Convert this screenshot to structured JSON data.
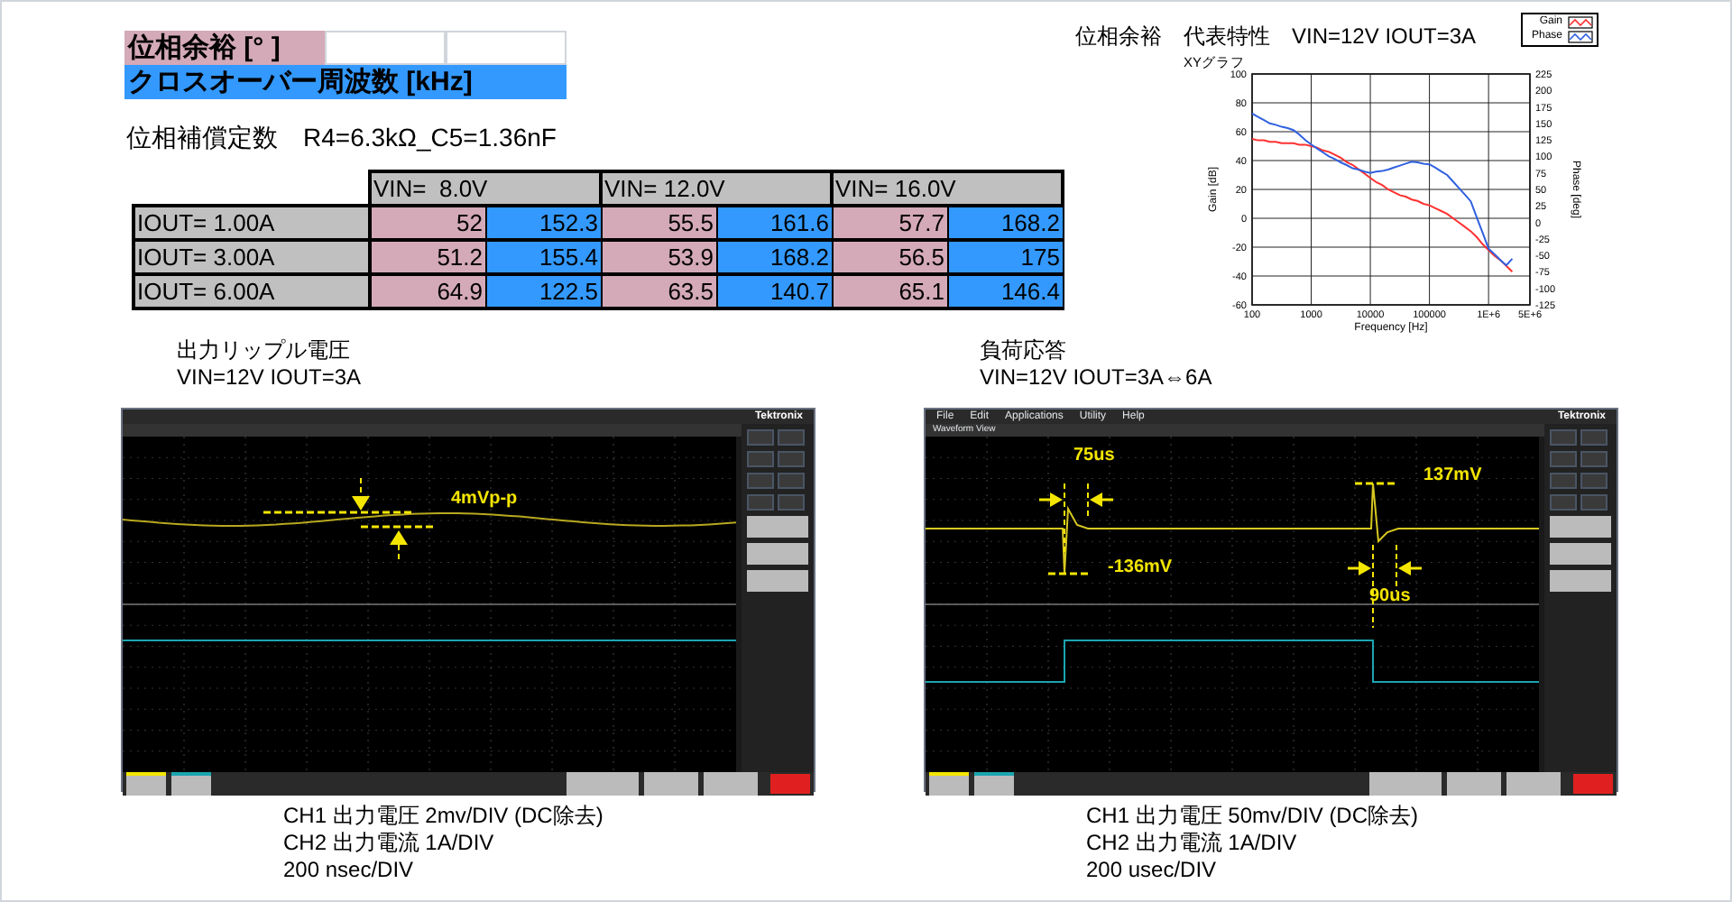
{
  "legend": [
    {
      "label": "位相余裕 [° ]",
      "kind": "phase"
    },
    {
      "label": "クロスオーバー周波数 [kHz]",
      "kind": "crossover"
    }
  ],
  "compensation": "位相補償定数　R4=6.3kΩ_C5=1.36nF",
  "table": {
    "column_groups": [
      "VIN=  8.0V",
      "VIN= 12.0V",
      "VIN= 16.0V"
    ],
    "rows": [
      {
        "label": "IOUT= 1.00A",
        "cells": [
          "52",
          "152.3",
          "55.5",
          "161.6",
          "57.7",
          "168.2"
        ]
      },
      {
        "label": "IOUT= 3.00A",
        "cells": [
          "51.2",
          "155.4",
          "53.9",
          "168.2",
          "56.5",
          "175"
        ]
      },
      {
        "label": "IOUT= 6.00A",
        "cells": [
          "64.9",
          "122.5",
          "63.5",
          "140.7",
          "65.1",
          "146.4"
        ]
      }
    ]
  },
  "bode": {
    "title": "位相余裕　代表特性　VIN=12V IOUT=3A",
    "caption": "XYグラフ",
    "chart_data": {
      "type": "line",
      "xlabel": "Frequency [Hz]",
      "ylabel": "Gain [dB]",
      "y2label": "Phase [deg]",
      "categories": [
        "100",
        null,
        null,
        null,
        null,
        null,
        null,
        null,
        null,
        null,
        "1000",
        null,
        null,
        null,
        null,
        null,
        null,
        null,
        null,
        null,
        "10000",
        null,
        null,
        null,
        null,
        null,
        null,
        null,
        null,
        null,
        "100000",
        null,
        null,
        null,
        null,
        null,
        null,
        null,
        null,
        null,
        "1E+6",
        null,
        null,
        null,
        null,
        null,
        null,
        "5E+6"
      ],
      "series": [
        {
          "name": "Gain",
          "color": "#ff3030",
          "values": [
            55,
            54,
            54,
            53,
            53,
            52,
            52,
            52,
            51,
            51,
            50,
            49,
            47,
            46,
            44,
            42,
            39,
            37,
            34,
            31,
            28,
            25,
            23,
            20,
            18,
            16,
            15,
            13,
            12,
            10,
            9,
            7,
            5,
            3,
            0,
            -3,
            -6,
            -9,
            -13,
            -18,
            -22,
            -26,
            -29,
            -33,
            -37,
            null,
            null,
            null
          ]
        },
        {
          "name": "Phase",
          "color": "#3060e0",
          "axis": "y2",
          "values": [
            165,
            160,
            155,
            150,
            148,
            145,
            143,
            140,
            133,
            125,
            118,
            112,
            106,
            100,
            96,
            91,
            87,
            82,
            80,
            77,
            75,
            77,
            78,
            80,
            83,
            86,
            89,
            92,
            91,
            89,
            88,
            83,
            77,
            72,
            62,
            52,
            42,
            32,
            8,
            -16,
            -40,
            -48,
            -57,
            -65,
            -55,
            null,
            null,
            null
          ]
        }
      ],
      "grid": true,
      "ylim": [
        -60,
        100
      ],
      "y2lim": [
        -125,
        225
      ],
      "yticks": [
        -60,
        -40,
        -20,
        0,
        20,
        40,
        60,
        80,
        100
      ],
      "y2ticks": [
        -125,
        -100,
        -75,
        -50,
        -25,
        0,
        25,
        50,
        75,
        100,
        125,
        150,
        175,
        200,
        225
      ]
    }
  },
  "scopes": [
    {
      "title": "出力リップル電圧",
      "condition": "VIN=12V IOUT=3A",
      "brand": "Tektronix",
      "annotations": [
        "4mVp-p"
      ],
      "notes": [
        "CH1 出力電圧 2mv/DIV (DC除去)",
        "CH2 出力電流 1A/DIV",
        "200 nsec/DIV"
      ]
    },
    {
      "title": "負荷応答",
      "condition": "VIN=12V IOUT=3A⇔6A",
      "brand": "Tektronix",
      "menu": [
        "File",
        "Edit",
        "Applications",
        "Utility",
        "Help"
      ],
      "view_title": "Waveform View",
      "annotations": [
        "75us",
        "137mV",
        "-136mV",
        "90us"
      ],
      "notes": [
        "CH1 出力電圧 50mv/DIV (DC除去)",
        "CH2 出力電流 1A/DIV",
        "200 usec/DIV"
      ]
    }
  ]
}
